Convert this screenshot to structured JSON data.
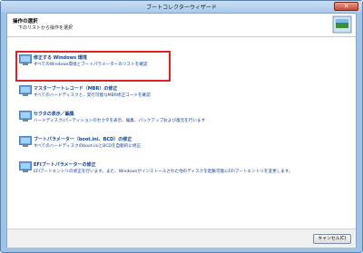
{
  "window": {
    "title": "ブートコレクターウィザード",
    "close_symbol": "✕"
  },
  "header": {
    "title": "操作の選択",
    "subtitle": "下のリストから操作を選択"
  },
  "options": [
    {
      "title": "修正する Windows 環境",
      "description": "すべてのWindows環境とブートパラメーターのリストを確認",
      "icon": "monitor-icon",
      "selected": true
    },
    {
      "title": "マスターブートレコード（MBR）の修正",
      "description": "すべてのハードディスクと、実行可能なMBR修正コードを確認",
      "icon": "monitor-icon",
      "selected": false
    },
    {
      "title": "セクタの表示／編集",
      "description": "ハードディスク/パーティションのセクタを表示、編集、バックアップおよび復元を行います",
      "icon": "monitor-icon",
      "selected": false
    },
    {
      "title": "ブートパラメーター（boot.ini、BCD）の修正",
      "description": "すべてのハードディスクのboot.iniとBCDを自動的に修正",
      "icon": "monitor-icon",
      "selected": false
    },
    {
      "title": "EFIブートパラメーターの修正",
      "description": "EFIブートエントリの修正を行います。また、Windowsがインストールされた他のディスクを起動可能にEFIブートエントリを変更します。",
      "icon": "monitor-icon",
      "selected": false
    }
  ],
  "footer": {
    "cancel_label": "キャンセル(C)"
  },
  "colors": {
    "link_blue": "#103f91",
    "highlight_red": "#e02222",
    "frame_blue": "#9ec3e6"
  }
}
